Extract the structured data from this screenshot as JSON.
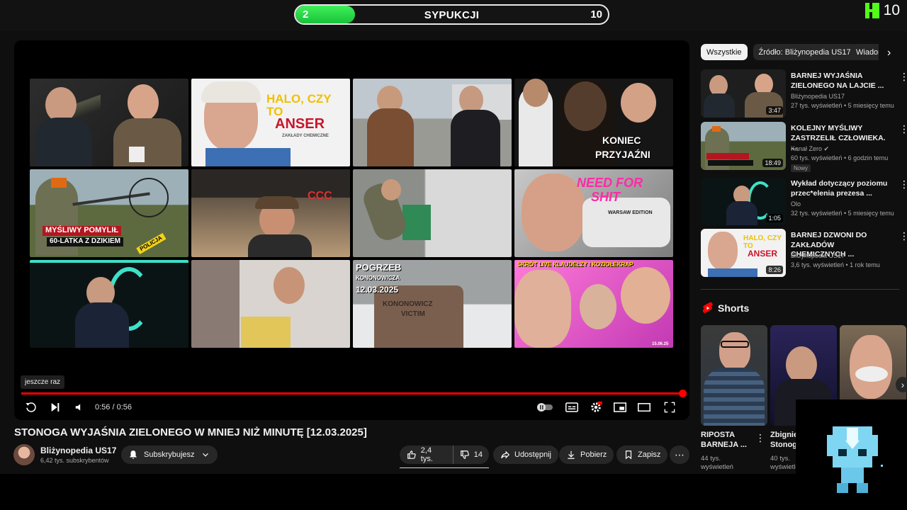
{
  "overlay": {
    "left_value": "2",
    "title": "SYPUKCJI",
    "right_value": "10",
    "fill_fraction": 0.19,
    "kick_count": "10",
    "kick_color": "#53fc18"
  },
  "player": {
    "tooltip": "jeszcze raz",
    "time": "0:56 / 0:56",
    "progress_fraction": 1.0,
    "progress_color": "#ff0000",
    "tiles": [
      {
        "caption": ""
      },
      {
        "caption": "HALO, CZY TO",
        "caption2": "ANSER",
        "caption3": "ZAKŁADY CHEMICZNE"
      },
      {
        "caption": ""
      },
      {
        "caption": "KONIEC",
        "caption2": "PRZYJAŹNI"
      },
      {
        "caption": "MYŚLIWY POMYLIŁ",
        "caption2": "60-LATKA Z DZIKIEM",
        "caption3": "POLICJA"
      },
      {
        "caption": "CCC"
      },
      {
        "caption": ""
      },
      {
        "caption": "NEED FOR",
        "caption2": "SHIT",
        "caption3": "WARSAW EDITION"
      },
      {
        "caption": ""
      },
      {
        "caption": ""
      },
      {
        "caption": "POGRZEB",
        "caption2": "KONONOWICZA",
        "caption3": "12.03.2025",
        "caption4": "KONONOWICZ",
        "caption5": "VICTIM"
      },
      {
        "caption": "SKRÓT LIVE KLAUDEŁZY I KOZIOŁEKRAP",
        "caption2": "15.06.25"
      }
    ]
  },
  "video": {
    "title": "STONOGA WYJAŚNIA ZIELONEGO W MNIEJ NIŻ MINUTĘ [12.03.2025]",
    "channel": "Bliżynopedia US17",
    "subs": "6,42 tys. subskrybentów",
    "subscribe_label": "Subskrybujesz",
    "likes": "2,4 tys.",
    "dislikes": "14",
    "share": "Udostępnij",
    "download": "Pobierz",
    "save": "Zapisz",
    "more": "⋯"
  },
  "sidebar": {
    "chips": [
      "Wszystkie",
      "Źródło: Bliżynopedia US17",
      "Wiadomości"
    ],
    "recs": [
      {
        "title": "BARNEJ WYJAŚNIA ZIELONEGO NA LAJCIE ...",
        "channel": "Bliżynopedia US17",
        "meta": "27 tys. wyświetleń • 5 miesięcy temu",
        "duration": "3:47",
        "badge": ""
      },
      {
        "title": "KOLEJNY MYŚLIWY ZASTRZELIŁ CZŁOWIEKA. ...",
        "channel": "Kanał Zero ✔",
        "meta": "60 tys. wyświetleń • 6 godzin temu",
        "duration": "18:49",
        "badge": "Nowy"
      },
      {
        "title": "Wykład dotyczący poziomu przec*elenia prezesa ...",
        "channel": "Olo",
        "meta": "32 tys. wyświetleń • 5 miesięcy temu",
        "duration": "1:05",
        "badge": ""
      },
      {
        "title": "BARNEJ DZWONI DO ZAKŁADÓW CHEMICZNYCH ...",
        "channel": "Bliżynopedia US17",
        "meta": "3,6 tys. wyświetleń • 1 rok temu",
        "duration": "8:26",
        "badge": ""
      }
    ],
    "shorts_heading": "Shorts",
    "shorts": [
      {
        "title": "RIPOSTA BARNEJA ...",
        "views1": "44 tys.",
        "views2": "wyświetleń"
      },
      {
        "title": "Zbigniew Stonoga",
        "views1": "40 tys.",
        "views2": "wyświetleń"
      },
      {
        "title": "",
        "views1": "",
        "views2": ""
      }
    ]
  }
}
